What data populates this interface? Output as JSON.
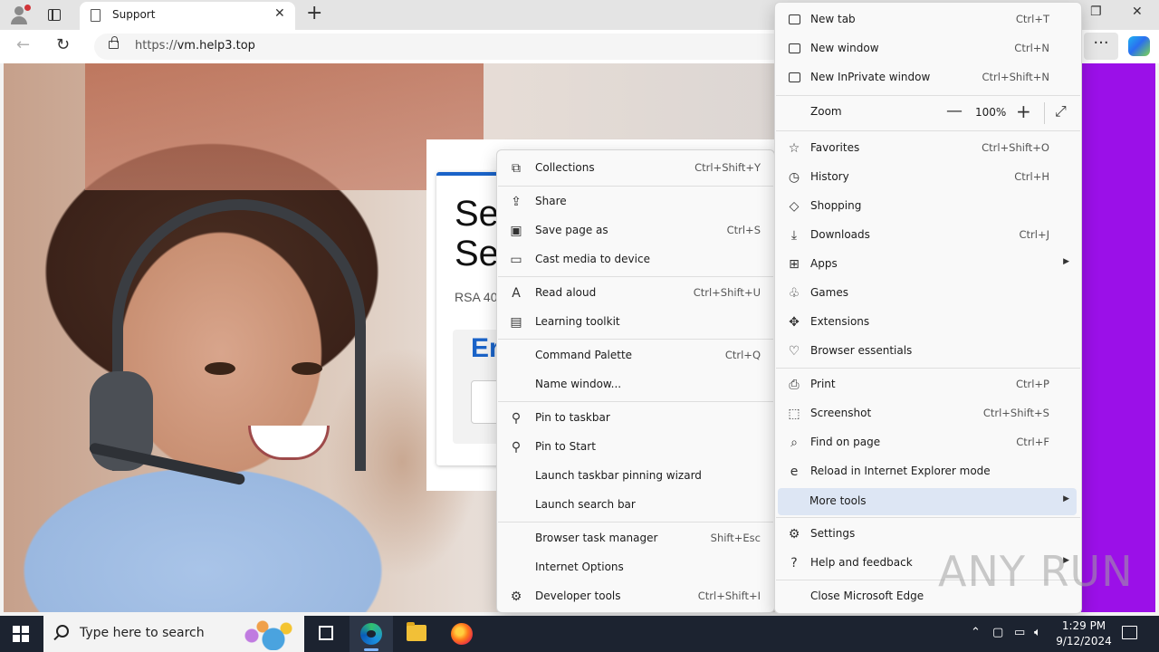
{
  "browser": {
    "tab_title": "Support",
    "url_prefix": "https://",
    "url_host": "vm.help3.top"
  },
  "page": {
    "heading": "Se\nSe",
    "subtext": "RSA 40",
    "panel_heading": "Er"
  },
  "main_menu": {
    "items": [
      {
        "label": "New tab",
        "shortcut": "Ctrl+T",
        "icon": "new-tab-icon"
      },
      {
        "label": "New window",
        "shortcut": "Ctrl+N",
        "icon": "new-window-icon"
      },
      {
        "label": "New InPrivate window",
        "shortcut": "Ctrl+Shift+N",
        "icon": "inprivate-icon"
      },
      {
        "label": "Zoom",
        "value": "100%",
        "minus": "—",
        "plus": "+",
        "icon": ""
      },
      {
        "label": "Favorites",
        "shortcut": "Ctrl+Shift+O",
        "icon": "star-icon"
      },
      {
        "label": "History",
        "shortcut": "Ctrl+H",
        "icon": "history-icon"
      },
      {
        "label": "Shopping",
        "shortcut": "",
        "icon": "tag-icon"
      },
      {
        "label": "Downloads",
        "shortcut": "Ctrl+J",
        "icon": "download-icon"
      },
      {
        "label": "Apps",
        "shortcut": "",
        "icon": "apps-icon"
      },
      {
        "label": "Games",
        "shortcut": "",
        "icon": "gamepad-icon"
      },
      {
        "label": "Extensions",
        "shortcut": "",
        "icon": "puzzle-icon"
      },
      {
        "label": "Browser essentials",
        "shortcut": "",
        "icon": "heart-pulse-icon"
      },
      {
        "label": "Print",
        "shortcut": "Ctrl+P",
        "icon": "printer-icon"
      },
      {
        "label": "Screenshot",
        "shortcut": "Ctrl+Shift+S",
        "icon": "screenshot-icon"
      },
      {
        "label": "Find on page",
        "shortcut": "Ctrl+F",
        "icon": "find-icon"
      },
      {
        "label": "Reload in Internet Explorer mode",
        "shortcut": "",
        "icon": "ie-icon"
      },
      {
        "label": "More tools",
        "shortcut": "",
        "icon": ""
      },
      {
        "label": "Settings",
        "shortcut": "",
        "icon": "gear-icon"
      },
      {
        "label": "Help and feedback",
        "shortcut": "",
        "icon": "help-icon"
      },
      {
        "label": "Close Microsoft Edge",
        "shortcut": "",
        "icon": ""
      }
    ]
  },
  "more_tools_menu": {
    "items": [
      {
        "label": "Collections",
        "shortcut": "Ctrl+Shift+Y",
        "icon": "collections-icon"
      },
      {
        "label": "Share",
        "shortcut": "",
        "icon": "share-icon"
      },
      {
        "label": "Save page as",
        "shortcut": "Ctrl+S",
        "icon": "save-icon"
      },
      {
        "label": "Cast media to device",
        "shortcut": "",
        "icon": "cast-icon"
      },
      {
        "label": "Read aloud",
        "shortcut": "Ctrl+Shift+U",
        "icon": "read-aloud-icon"
      },
      {
        "label": "Learning toolkit",
        "shortcut": "",
        "icon": "learning-icon"
      },
      {
        "label": "Command Palette",
        "shortcut": "Ctrl+Q",
        "icon": ""
      },
      {
        "label": "Name window...",
        "shortcut": "",
        "icon": ""
      },
      {
        "label": "Pin to taskbar",
        "shortcut": "",
        "icon": "pin-icon"
      },
      {
        "label": "Pin to Start",
        "shortcut": "",
        "icon": "pin-icon"
      },
      {
        "label": "Launch taskbar pinning wizard",
        "shortcut": "",
        "icon": ""
      },
      {
        "label": "Launch search bar",
        "shortcut": "",
        "icon": ""
      },
      {
        "label": "Browser task manager",
        "shortcut": "Shift+Esc",
        "icon": ""
      },
      {
        "label": "Internet Options",
        "shortcut": "",
        "icon": ""
      },
      {
        "label": "Developer tools",
        "shortcut": "Ctrl+Shift+I",
        "icon": "devtools-icon"
      }
    ]
  },
  "taskbar": {
    "search_placeholder": "Type here to search",
    "time": "1:29 PM",
    "date": "9/12/2024"
  },
  "watermark": "ANY RUN",
  "colors": {
    "accent": "#1a63c8",
    "purple_strip": "#9b10e8",
    "menu_highlight": "#dde6f4",
    "taskbar": "#1c2330"
  }
}
